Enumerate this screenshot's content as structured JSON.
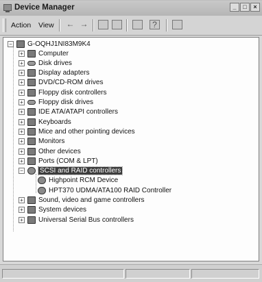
{
  "window": {
    "title": "Device Manager"
  },
  "window_controls": {
    "minimize": "_",
    "maximize": "□",
    "close": "×"
  },
  "menu": {
    "action": "Action",
    "view": "View"
  },
  "toolbar": {
    "icons": [
      "back-arrow-icon",
      "forward-arrow-icon",
      "tree-view-icon",
      "properties-icon",
      "print-icon",
      "help-icon",
      "scan-hardware-icon"
    ]
  },
  "tree": {
    "root": "G-OQHJ1NI83M9K4",
    "items": [
      {
        "label": "Computer",
        "expander": "+",
        "icon": "computer-icon"
      },
      {
        "label": "Disk drives",
        "expander": "+",
        "icon": "disk-drive-icon"
      },
      {
        "label": "Display adapters",
        "expander": "+",
        "icon": "display-adapter-icon"
      },
      {
        "label": "DVD/CD-ROM drives",
        "expander": "+",
        "icon": "dvd-drive-icon"
      },
      {
        "label": "Floppy disk controllers",
        "expander": "+",
        "icon": "floppy-controller-icon"
      },
      {
        "label": "Floppy disk drives",
        "expander": "+",
        "icon": "floppy-drive-icon"
      },
      {
        "label": "IDE ATA/ATAPI controllers",
        "expander": "+",
        "icon": "ide-controller-icon"
      },
      {
        "label": "Keyboards",
        "expander": "+",
        "icon": "keyboard-icon"
      },
      {
        "label": "Mice and other pointing devices",
        "expander": "+",
        "icon": "mouse-icon"
      },
      {
        "label": "Monitors",
        "expander": "+",
        "icon": "monitor-icon"
      },
      {
        "label": "Other devices",
        "expander": "+",
        "icon": "question-icon"
      },
      {
        "label": "Ports (COM & LPT)",
        "expander": "+",
        "icon": "port-icon"
      },
      {
        "label": "SCSI and RAID controllers",
        "expander": "−",
        "icon": "scsi-controller-icon",
        "selected": true,
        "children": [
          "Highpoint RCM Device",
          "HPT370 UDMA/ATA100 RAID Controller"
        ]
      },
      {
        "label": "Sound, video and game controllers",
        "expander": "+",
        "icon": "sound-icon"
      },
      {
        "label": "System devices",
        "expander": "+",
        "icon": "system-device-icon"
      },
      {
        "label": "Universal Serial Bus controllers",
        "expander": "+",
        "icon": "usb-icon"
      }
    ]
  }
}
